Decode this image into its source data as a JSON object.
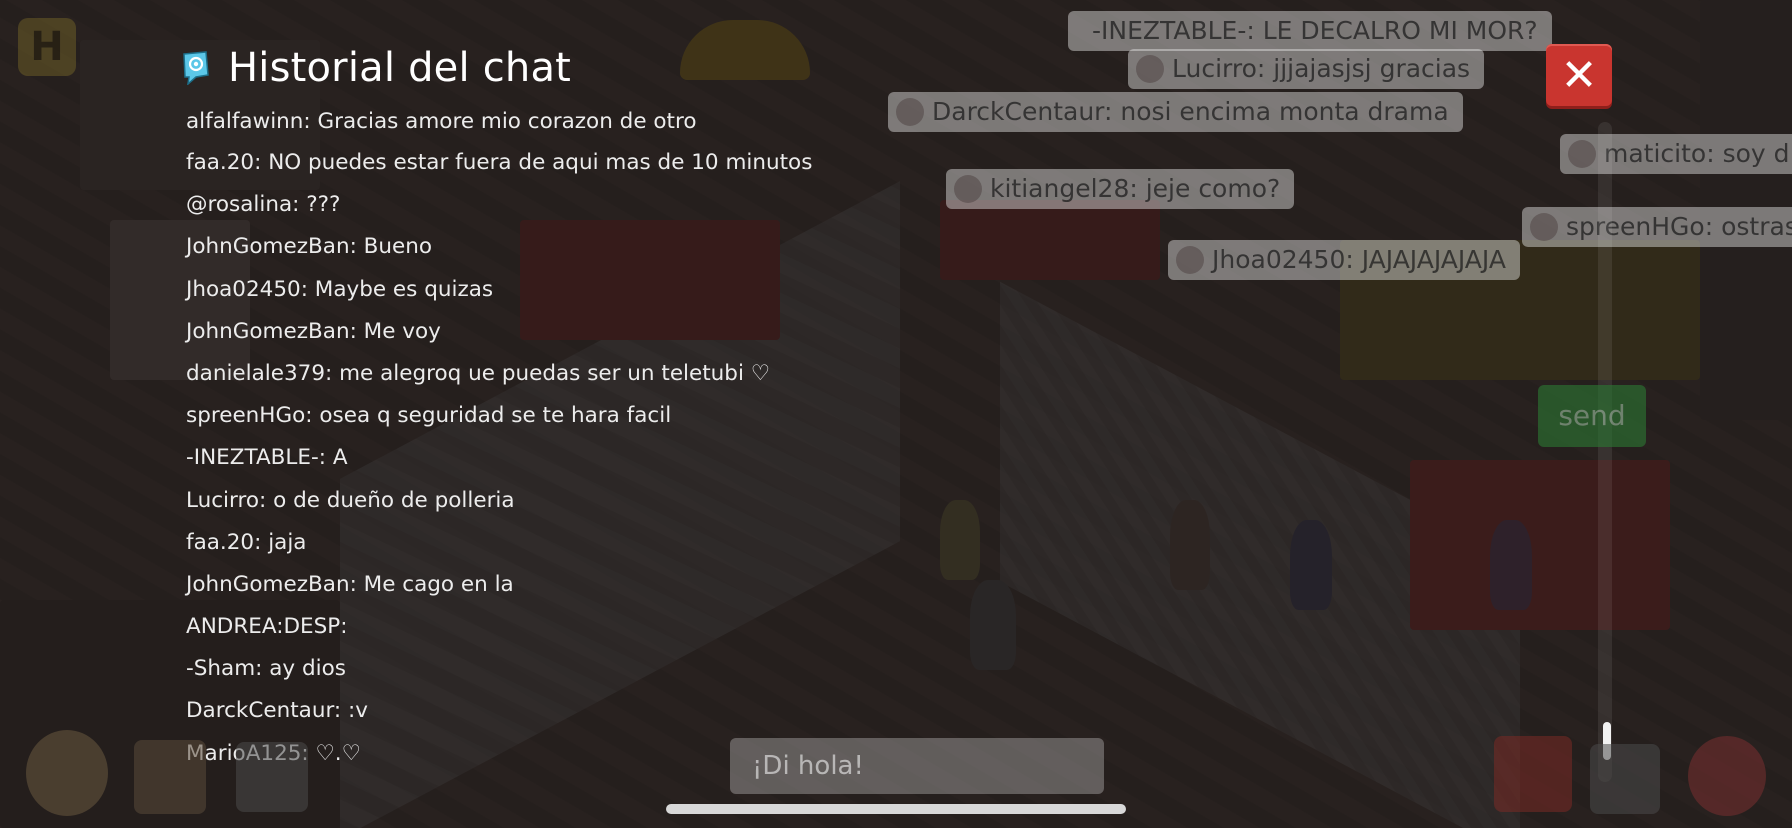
{
  "header": {
    "title": "Historial del chat"
  },
  "close_label": "✕",
  "chat_history": [
    {
      "user": "alfalfawinn",
      "text": "Gracias amore mio corazon de otro"
    },
    {
      "user": "faa.20",
      "text": "NO puedes estar fuera de aqui mas de 10 minutos"
    },
    {
      "user": "@rosalina",
      "text": "???"
    },
    {
      "user": "JohnGomezBan",
      "text": "Bueno"
    },
    {
      "user": "Jhoa02450",
      "text": "Maybe es quizas"
    },
    {
      "user": "JohnGomezBan",
      "text": "Me voy"
    },
    {
      "user": "danielale379",
      "text": "me alegroq ue puedas ser un teletubi ♡"
    },
    {
      "user": "spreenHGo",
      "text": "osea q seguridad se te hara facil"
    },
    {
      "user": "-INEZTABLE-",
      "text": "A"
    },
    {
      "user": "Lucirro",
      "text": "o de dueño de polleria"
    },
    {
      "user": "faa.20",
      "text": "jaja"
    },
    {
      "user": "JohnGomezBan",
      "text": "Me cago en la"
    },
    {
      "user": "ANDREA",
      "text": "DESP:"
    },
    {
      "user": "-Sham",
      "text": "ay dios"
    },
    {
      "user": "DarckCentaur",
      "text": ":v"
    },
    {
      "user": "MarioA125",
      "text": "♡.♡"
    }
  ],
  "chat_lines": [
    "alfalfawinn: Gracias amore mio corazon de otro",
    "faa.20: NO puedes estar fuera de aqui mas de 10 minutos",
    "@rosalina: ???",
    "JohnGomezBan: Bueno",
    "Jhoa02450: Maybe es quizas",
    "JohnGomezBan: Me voy",
    "danielale379: me alegroq ue puedas ser un teletubi ♡",
    "spreenHGo: osea q seguridad se te hara facil",
    "-INEZTABLE-: A",
    "Lucirro: o de dueño de polleria",
    "faa.20: jaja",
    "JohnGomezBan: Me cago en la",
    "ANDREA:DESP:",
    "-Sham: ay dios",
    "DarckCentaur: :v",
    "MarioA125: ♡.♡"
  ],
  "room_bubbles": [
    "-INEZTABLE-: LE DECALRO MI MOR?",
    "Lucirro: jjjajasjsj gracias",
    "DarckCentaur: nosi encima monta drama",
    "maticito: soy d",
    "kitiangel28: jeje como?",
    "spreenHGo: ostras",
    "Jhoa02450: JAJAJAJAJAJA"
  ],
  "chat_input": {
    "placeholder": "¡Di hola!"
  },
  "send_label": "send",
  "colors": {
    "close_button": "#c9352f",
    "text": "#ececec",
    "title": "#ffffff",
    "overlay": "rgba(28,24,24,0.72)"
  },
  "icons": [
    "chat-history-icon",
    "close-icon",
    "hotel-home-icon",
    "user-avatar-icon",
    "catalog-icon",
    "navigator-icon",
    "shop-icon",
    "inventory-icon",
    "profile-icon"
  ]
}
